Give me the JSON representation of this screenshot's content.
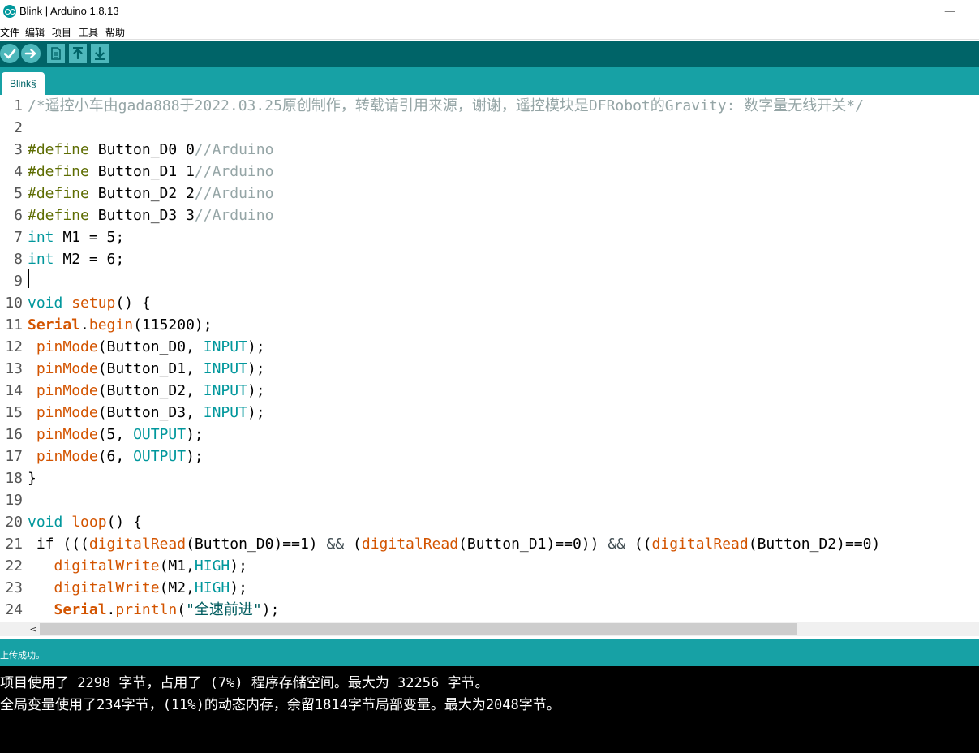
{
  "window": {
    "title": "Blink | Arduino 1.8.13",
    "minimize_glyph": "—"
  },
  "menu": [
    "文件",
    "编辑",
    "项目",
    "工具",
    "帮助"
  ],
  "toolbar": {
    "buttons": [
      {
        "name": "verify",
        "icon": "checkmark-icon"
      },
      {
        "name": "upload",
        "icon": "arrow-right-icon"
      },
      {
        "name": "new",
        "icon": "new-file-icon"
      },
      {
        "name": "open",
        "icon": "arrow-up-icon"
      },
      {
        "name": "save",
        "icon": "arrow-down-icon"
      }
    ]
  },
  "tab": {
    "label": "Blink§"
  },
  "editor": {
    "lines": [
      {
        "n": "1",
        "tokens": [
          [
            "/*遥控小车由gada888于2022.03.25原创制作，转载请引用来源，谢谢，遥控模块是DFRobot的Gravity: 数字量无线开关*/",
            "comment"
          ]
        ]
      },
      {
        "n": "2",
        "tokens": []
      },
      {
        "n": "3",
        "tokens": [
          [
            "#define",
            "pre"
          ],
          [
            " Button_D0 0",
            ""
          ],
          [
            "//Arduino",
            "comment"
          ]
        ]
      },
      {
        "n": "4",
        "tokens": [
          [
            "#define",
            "pre"
          ],
          [
            " Button_D1 1",
            ""
          ],
          [
            "//Arduino",
            "comment"
          ]
        ]
      },
      {
        "n": "5",
        "tokens": [
          [
            "#define",
            "pre"
          ],
          [
            " Button_D2 2",
            ""
          ],
          [
            "//Arduino",
            "comment"
          ]
        ]
      },
      {
        "n": "6",
        "tokens": [
          [
            "#define",
            "pre"
          ],
          [
            " Button_D3 3",
            ""
          ],
          [
            "//Arduino",
            "comment"
          ]
        ]
      },
      {
        "n": "7",
        "tokens": [
          [
            "int",
            "type"
          ],
          [
            " M1 = 5;",
            ""
          ]
        ]
      },
      {
        "n": "8",
        "tokens": [
          [
            "int",
            "type"
          ],
          [
            " M2 = 6;",
            ""
          ]
        ]
      },
      {
        "n": "9",
        "tokens": []
      },
      {
        "n": "10",
        "tokens": [
          [
            "void",
            "type"
          ],
          [
            " ",
            ""
          ],
          [
            "setup",
            "fn"
          ],
          [
            "() {",
            ""
          ]
        ]
      },
      {
        "n": "11",
        "tokens": [
          [
            "Serial",
            "cls"
          ],
          [
            ".",
            ""
          ],
          [
            "begin",
            "fn"
          ],
          [
            "(115200);",
            ""
          ]
        ]
      },
      {
        "n": "12",
        "tokens": [
          [
            " ",
            ""
          ],
          [
            "pinMode",
            "fn"
          ],
          [
            "(Button_D0, ",
            ""
          ],
          [
            "INPUT",
            "const"
          ],
          [
            ");",
            ""
          ]
        ]
      },
      {
        "n": "13",
        "tokens": [
          [
            " ",
            ""
          ],
          [
            "pinMode",
            "fn"
          ],
          [
            "(Button_D1, ",
            ""
          ],
          [
            "INPUT",
            "const"
          ],
          [
            ");",
            ""
          ]
        ]
      },
      {
        "n": "14",
        "tokens": [
          [
            " ",
            ""
          ],
          [
            "pinMode",
            "fn"
          ],
          [
            "(Button_D2, ",
            ""
          ],
          [
            "INPUT",
            "const"
          ],
          [
            ");",
            ""
          ]
        ]
      },
      {
        "n": "15",
        "tokens": [
          [
            " ",
            ""
          ],
          [
            "pinMode",
            "fn"
          ],
          [
            "(Button_D3, ",
            ""
          ],
          [
            "INPUT",
            "const"
          ],
          [
            ");",
            ""
          ]
        ]
      },
      {
        "n": "16",
        "tokens": [
          [
            " ",
            ""
          ],
          [
            "pinMode",
            "fn"
          ],
          [
            "(5, ",
            ""
          ],
          [
            "OUTPUT",
            "const"
          ],
          [
            ");",
            ""
          ]
        ]
      },
      {
        "n": "17",
        "tokens": [
          [
            " ",
            ""
          ],
          [
            "pinMode",
            "fn"
          ],
          [
            "(6, ",
            ""
          ],
          [
            "OUTPUT",
            "const"
          ],
          [
            ");",
            ""
          ]
        ]
      },
      {
        "n": "18",
        "tokens": [
          [
            "}",
            ""
          ]
        ]
      },
      {
        "n": "19",
        "tokens": []
      },
      {
        "n": "20",
        "tokens": [
          [
            "void",
            "type"
          ],
          [
            " ",
            ""
          ],
          [
            "loop",
            "fn"
          ],
          [
            "() {",
            ""
          ]
        ]
      },
      {
        "n": "21",
        "tokens": [
          [
            " if",
            ""
          ],
          [
            " (((",
            ""
          ],
          [
            "digitalRead",
            "fn"
          ],
          [
            "(Button_D0)==1) ",
            ""
          ],
          [
            "&&",
            "op"
          ],
          [
            " (",
            ""
          ],
          [
            "digitalRead",
            "fn"
          ],
          [
            "(Button_D1)==0)) ",
            ""
          ],
          [
            "&&",
            "op"
          ],
          [
            " ((",
            ""
          ],
          [
            "digitalRead",
            "fn"
          ],
          [
            "(Button_D2)==0)",
            ""
          ]
        ]
      },
      {
        "n": "22",
        "tokens": [
          [
            "   ",
            ""
          ],
          [
            "digitalWrite",
            "fn"
          ],
          [
            "(M1,",
            ""
          ],
          [
            "HIGH",
            "const"
          ],
          [
            ");",
            ""
          ]
        ]
      },
      {
        "n": "23",
        "tokens": [
          [
            "   ",
            ""
          ],
          [
            "digitalWrite",
            "fn"
          ],
          [
            "(M2,",
            ""
          ],
          [
            "HIGH",
            "const"
          ],
          [
            ");",
            ""
          ]
        ]
      },
      {
        "n": "24",
        "tokens": [
          [
            "   ",
            ""
          ],
          [
            "Serial",
            "cls"
          ],
          [
            ".",
            ""
          ],
          [
            "println",
            "fn"
          ],
          [
            "(",
            ""
          ],
          [
            "\"全速前进\"",
            "str"
          ],
          [
            ");",
            ""
          ]
        ]
      }
    ]
  },
  "scrollbar": {
    "left_arrow": "<"
  },
  "status": {
    "message": "上传成功。"
  },
  "console": {
    "lines": [
      "项目使用了 2298 字节，占用了 (7%) 程序存储空间。最大为 32256 字节。",
      "全局变量使用了234字节，(11%)的动态内存，余留1814字节局部变量。最大为2048字节。"
    ]
  }
}
